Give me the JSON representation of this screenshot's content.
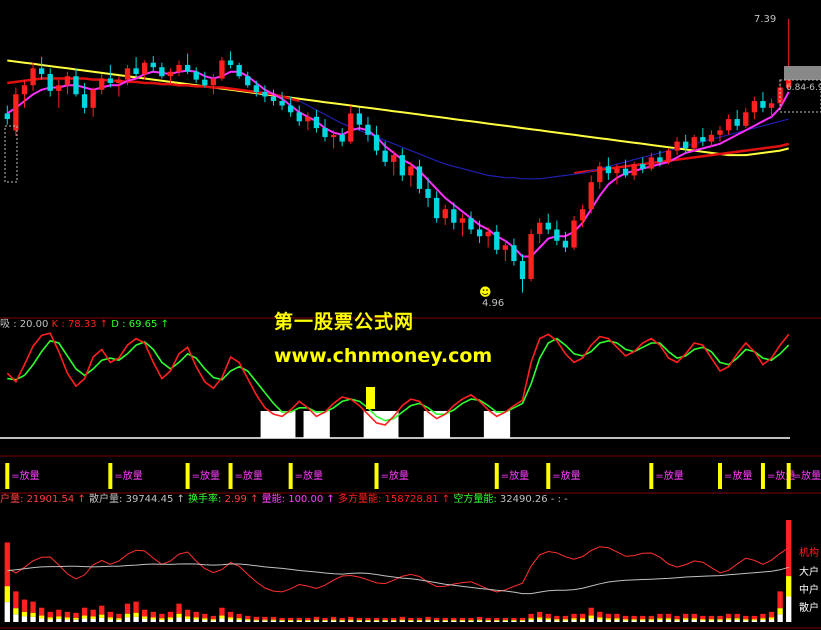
{
  "watermark": {
    "title": "第一股票公式网",
    "url": "www.chnmoney.com"
  },
  "colors": {
    "up": "#ff2020",
    "down": "#00d8e0",
    "ma_yellow": "#ffff40",
    "ma_red": "#e01010",
    "ma_blue": "#2020b0",
    "ma_magenta": "#ff30ff",
    "kdj_k": "#ff2020",
    "kdj_d": "#30ff30",
    "grid": "#800000"
  },
  "main_panel": {
    "high_label": "7.39",
    "low_label": "4.96",
    "price_box_label": "6.84-6.9"
  },
  "kdj_panel": {
    "label_prefix": "吸",
    "label_prefix_value": "20.00",
    "k_label": "K",
    "k_value": "78.33",
    "d_label": "D",
    "d_value": "69.65"
  },
  "signal_panel": {
    "signal_text": "=放量"
  },
  "volume_panel": {
    "items": [
      {
        "label": "户量:",
        "value": "21901.54"
      },
      {
        "label": "散户量:",
        "value": "39744.45"
      },
      {
        "label": "换手率:",
        "value": "2.99"
      },
      {
        "label": "量能:",
        "value": "100.00"
      },
      {
        "label": "多方量能:",
        "value": "158728.81"
      },
      {
        "label": "空方量能:",
        "value": "32490.26"
      }
    ],
    "legend": [
      "机构",
      "大户",
      "中户",
      "散户"
    ]
  },
  "chart_data": {
    "type": "candlestick",
    "ohlc": [
      [
        6.55,
        6.62,
        6.45,
        6.5
      ],
      [
        6.4,
        6.78,
        6.35,
        6.72
      ],
      [
        6.72,
        6.85,
        6.6,
        6.8
      ],
      [
        6.8,
        7.0,
        6.75,
        6.95
      ],
      [
        6.95,
        7.05,
        6.85,
        6.9
      ],
      [
        6.9,
        6.95,
        6.7,
        6.75
      ],
      [
        6.75,
        6.85,
        6.6,
        6.8
      ],
      [
        6.8,
        6.92,
        6.72,
        6.88
      ],
      [
        6.88,
        6.95,
        6.7,
        6.72
      ],
      [
        6.72,
        6.82,
        6.55,
        6.6
      ],
      [
        6.6,
        6.78,
        6.52,
        6.76
      ],
      [
        6.76,
        6.9,
        6.72,
        6.86
      ],
      [
        6.86,
        6.98,
        6.78,
        6.82
      ],
      [
        6.82,
        6.88,
        6.7,
        6.85
      ],
      [
        6.85,
        6.98,
        6.8,
        6.95
      ],
      [
        6.95,
        7.05,
        6.88,
        6.9
      ],
      [
        6.9,
        7.02,
        6.85,
        7.0
      ],
      [
        7.0,
        7.06,
        6.92,
        6.96
      ],
      [
        6.96,
        7.0,
        6.86,
        6.88
      ],
      [
        6.88,
        6.95,
        6.8,
        6.92
      ],
      [
        6.92,
        7.02,
        6.88,
        6.98
      ],
      [
        6.98,
        7.08,
        6.9,
        6.92
      ],
      [
        6.92,
        6.96,
        6.82,
        6.85
      ],
      [
        6.85,
        6.92,
        6.78,
        6.8
      ],
      [
        6.8,
        6.9,
        6.72,
        6.86
      ],
      [
        6.86,
        7.05,
        6.84,
        7.02
      ],
      [
        7.02,
        7.1,
        6.95,
        6.98
      ],
      [
        6.98,
        7.0,
        6.86,
        6.88
      ],
      [
        6.88,
        6.92,
        6.78,
        6.8
      ],
      [
        6.8,
        6.84,
        6.7,
        6.74
      ],
      [
        6.74,
        6.8,
        6.65,
        6.7
      ],
      [
        6.7,
        6.76,
        6.62,
        6.66
      ],
      [
        6.66,
        6.74,
        6.58,
        6.62
      ],
      [
        6.62,
        6.7,
        6.52,
        6.56
      ],
      [
        6.56,
        6.62,
        6.44,
        6.48
      ],
      [
        6.48,
        6.56,
        6.4,
        6.52
      ],
      [
        6.52,
        6.58,
        6.38,
        6.42
      ],
      [
        6.42,
        6.5,
        6.3,
        6.34
      ],
      [
        6.34,
        6.4,
        6.24,
        6.36
      ],
      [
        6.36,
        6.42,
        6.26,
        6.3
      ],
      [
        6.3,
        6.62,
        6.28,
        6.55
      ],
      [
        6.55,
        6.6,
        6.4,
        6.45
      ],
      [
        6.45,
        6.52,
        6.3,
        6.36
      ],
      [
        6.36,
        6.44,
        6.18,
        6.22
      ],
      [
        6.22,
        6.3,
        6.08,
        6.12
      ],
      [
        6.12,
        6.22,
        6.0,
        6.18
      ],
      [
        6.18,
        6.24,
        5.95,
        6.0
      ],
      [
        6.0,
        6.12,
        5.9,
        6.08
      ],
      [
        6.08,
        6.14,
        5.84,
        5.88
      ],
      [
        5.88,
        5.98,
        5.72,
        5.8
      ],
      [
        5.8,
        5.86,
        5.58,
        5.62
      ],
      [
        5.62,
        5.74,
        5.56,
        5.7
      ],
      [
        5.7,
        5.76,
        5.52,
        5.58
      ],
      [
        5.58,
        5.66,
        5.46,
        5.62
      ],
      [
        5.62,
        5.68,
        5.48,
        5.52
      ],
      [
        5.52,
        5.6,
        5.4,
        5.46
      ],
      [
        5.46,
        5.54,
        5.36,
        5.5
      ],
      [
        5.5,
        5.56,
        5.3,
        5.34
      ],
      [
        5.34,
        5.42,
        5.24,
        5.38
      ],
      [
        5.38,
        5.44,
        5.2,
        5.24
      ],
      [
        5.24,
        5.3,
        4.96,
        5.08
      ],
      [
        5.08,
        5.52,
        5.06,
        5.48
      ],
      [
        5.48,
        5.62,
        5.4,
        5.58
      ],
      [
        5.58,
        5.66,
        5.48,
        5.52
      ],
      [
        5.52,
        5.6,
        5.38,
        5.42
      ],
      [
        5.42,
        5.5,
        5.32,
        5.36
      ],
      [
        5.36,
        5.64,
        5.34,
        5.6
      ],
      [
        5.6,
        5.74,
        5.54,
        5.7
      ],
      [
        5.7,
        6.0,
        5.66,
        5.94
      ],
      [
        5.94,
        6.12,
        5.88,
        6.08
      ],
      [
        6.08,
        6.16,
        5.96,
        6.02
      ],
      [
        6.02,
        6.1,
        5.92,
        6.06
      ],
      [
        6.06,
        6.14,
        5.98,
        6.0
      ],
      [
        6.0,
        6.12,
        5.96,
        6.1
      ],
      [
        6.1,
        6.16,
        6.02,
        6.06
      ],
      [
        6.06,
        6.2,
        6.04,
        6.16
      ],
      [
        6.16,
        6.22,
        6.08,
        6.12
      ],
      [
        6.12,
        6.24,
        6.1,
        6.22
      ],
      [
        6.22,
        6.34,
        6.18,
        6.3
      ],
      [
        6.3,
        6.36,
        6.2,
        6.24
      ],
      [
        6.24,
        6.36,
        6.22,
        6.34
      ],
      [
        6.34,
        6.42,
        6.26,
        6.3
      ],
      [
        6.3,
        6.4,
        6.26,
        6.36
      ],
      [
        6.36,
        6.44,
        6.3,
        6.4
      ],
      [
        6.4,
        6.54,
        6.36,
        6.5
      ],
      [
        6.5,
        6.58,
        6.4,
        6.44
      ],
      [
        6.44,
        6.6,
        6.42,
        6.56
      ],
      [
        6.56,
        6.7,
        6.5,
        6.66
      ],
      [
        6.66,
        6.74,
        6.56,
        6.6
      ],
      [
        6.6,
        6.68,
        6.52,
        6.64
      ],
      [
        6.64,
        6.82,
        6.6,
        6.78
      ],
      [
        6.78,
        7.39,
        6.76,
        6.9
      ]
    ],
    "ma": {
      "yellow": [
        7.02,
        7.01,
        7.0,
        6.99,
        6.98,
        6.97,
        6.96,
        6.95,
        6.94,
        6.93,
        6.92,
        6.91,
        6.9,
        6.89,
        6.88,
        6.87,
        6.86,
        6.85,
        6.84,
        6.83,
        6.82,
        6.81,
        6.8,
        6.79,
        6.78,
        6.77,
        6.76,
        6.75,
        6.74,
        6.73,
        6.72,
        6.71,
        6.7,
        6.69,
        6.68,
        6.67,
        6.66,
        6.65,
        6.64,
        6.63,
        6.62,
        6.61,
        6.6,
        6.59,
        6.58,
        6.57,
        6.56,
        6.55,
        6.54,
        6.53,
        6.52,
        6.51,
        6.5,
        6.49,
        6.48,
        6.47,
        6.46,
        6.45,
        6.44,
        6.43,
        6.42,
        6.41,
        6.4,
        6.39,
        6.38,
        6.37,
        6.36,
        6.35,
        6.34,
        6.33,
        6.32,
        6.31,
        6.3,
        6.29,
        6.28,
        6.27,
        6.26,
        6.25,
        6.24,
        6.23,
        6.22,
        6.21,
        6.2,
        6.19,
        6.18,
        6.18,
        6.18,
        6.19,
        6.2,
        6.21,
        6.22,
        6.24
      ],
      "red": [
        6.82,
        6.83,
        6.84,
        6.85,
        6.86,
        6.86,
        6.86,
        6.86,
        6.86,
        6.86,
        6.85,
        6.85,
        6.84,
        6.84,
        6.83,
        6.83,
        6.82,
        6.82,
        6.81,
        6.81,
        6.8,
        6.8,
        6.79,
        6.79,
        6.78,
        6.78,
        6.77,
        6.76,
        6.75,
        6.74,
        6.73,
        6.72,
        6.7,
        6.68,
        6.66,
        null,
        null,
        null,
        null,
        null,
        null,
        null,
        null,
        null,
        null,
        null,
        null,
        null,
        null,
        null,
        null,
        null,
        null,
        null,
        null,
        null,
        null,
        null,
        null,
        null,
        null,
        null,
        null,
        null,
        null,
        null,
        6.02,
        6.03,
        6.04,
        6.05,
        6.06,
        6.07,
        6.08,
        6.09,
        6.1,
        6.11,
        6.12,
        6.13,
        6.14,
        6.15,
        6.16,
        6.17,
        6.18,
        6.19,
        6.2,
        6.21,
        6.22,
        6.23,
        6.24,
        6.25,
        6.26,
        6.28
      ],
      "blue": [
        null,
        null,
        null,
        null,
        null,
        null,
        null,
        null,
        null,
        null,
        null,
        null,
        null,
        null,
        null,
        null,
        null,
        null,
        null,
        null,
        null,
        null,
        null,
        null,
        null,
        null,
        null,
        null,
        null,
        null,
        null,
        null,
        null,
        null,
        6.66,
        6.62,
        6.58,
        6.54,
        6.5,
        6.46,
        6.43,
        6.4,
        6.37,
        6.34,
        6.31,
        6.28,
        6.25,
        6.22,
        6.19,
        6.16,
        6.13,
        6.1,
        6.08,
        6.06,
        6.04,
        6.02,
        6.0,
        5.99,
        5.98,
        5.98,
        5.97,
        5.97,
        5.97,
        5.98,
        5.99,
        6.0,
        6.01,
        6.02,
        6.04,
        6.06,
        6.08,
        6.1,
        6.12,
        6.14,
        6.16,
        6.18,
        6.2,
        6.22,
        6.24,
        6.26,
        6.28,
        6.3,
        6.32,
        6.34,
        6.36,
        6.38,
        6.4,
        6.42,
        6.44,
        6.46,
        6.48,
        6.5
      ],
      "magenta": [
        6.55,
        6.6,
        6.66,
        6.72,
        6.76,
        6.78,
        6.78,
        6.8,
        6.8,
        6.78,
        6.76,
        6.78,
        6.8,
        6.8,
        6.84,
        6.86,
        6.9,
        6.92,
        6.91,
        6.9,
        6.92,
        6.93,
        6.92,
        6.88,
        6.86,
        6.88,
        6.92,
        6.92,
        6.88,
        6.82,
        6.76,
        6.72,
        6.68,
        6.62,
        6.56,
        6.52,
        6.48,
        6.42,
        6.38,
        6.36,
        6.4,
        6.42,
        6.4,
        6.34,
        6.26,
        6.2,
        6.14,
        6.1,
        6.04,
        5.96,
        5.88,
        5.8,
        5.74,
        5.68,
        5.62,
        5.56,
        5.52,
        5.46,
        5.42,
        5.36,
        5.28,
        5.28,
        5.36,
        5.44,
        5.46,
        5.46,
        5.5,
        5.58,
        5.7,
        5.82,
        5.92,
        5.98,
        6.02,
        6.04,
        6.06,
        6.08,
        6.1,
        6.12,
        6.16,
        6.2,
        6.22,
        6.24,
        6.26,
        6.28,
        6.32,
        6.36,
        6.4,
        6.44,
        6.48,
        6.52,
        6.6,
        6.74
      ]
    },
    "kdj": {
      "k": [
        60,
        52,
        68,
        85,
        95,
        97,
        80,
        60,
        48,
        55,
        75,
        82,
        70,
        74,
        86,
        92,
        88,
        70,
        55,
        62,
        78,
        84,
        66,
        52,
        46,
        56,
        75,
        70,
        55,
        40,
        28,
        22,
        20,
        26,
        34,
        28,
        20,
        24,
        32,
        38,
        36,
        30,
        22,
        14,
        12,
        20,
        30,
        36,
        34,
        24,
        18,
        22,
        30,
        36,
        40,
        34,
        26,
        20,
        24,
        30,
        35,
        70,
        92,
        96,
        90,
        78,
        70,
        74,
        86,
        94,
        92,
        84,
        76,
        80,
        88,
        92,
        86,
        74,
        70,
        78,
        88,
        86,
        74,
        62,
        66,
        78,
        88,
        80,
        68,
        74,
        86,
        96
      ],
      "d": [
        55,
        54,
        58,
        68,
        80,
        90,
        88,
        76,
        64,
        58,
        64,
        72,
        74,
        72,
        78,
        86,
        89,
        82,
        70,
        64,
        70,
        78,
        74,
        64,
        56,
        54,
        62,
        66,
        62,
        52,
        42,
        32,
        24,
        24,
        28,
        28,
        24,
        24,
        28,
        34,
        36,
        34,
        28,
        20,
        16,
        18,
        24,
        30,
        32,
        28,
        22,
        22,
        26,
        32,
        36,
        35,
        30,
        24,
        24,
        28,
        32,
        50,
        74,
        88,
        92,
        86,
        78,
        76,
        80,
        88,
        90,
        88,
        82,
        80,
        84,
        88,
        88,
        80,
        74,
        76,
        82,
        84,
        80,
        70,
        68,
        74,
        82,
        80,
        74,
        72,
        78,
        86
      ]
    },
    "volume": [
      78,
      30,
      22,
      20,
      14,
      10,
      12,
      10,
      9,
      14,
      12,
      16,
      10,
      8,
      18,
      20,
      12,
      10,
      8,
      10,
      18,
      12,
      10,
      8,
      6,
      14,
      10,
      8,
      6,
      5,
      5,
      5,
      4,
      4,
      4,
      4,
      5,
      4,
      5,
      4,
      5,
      4,
      4,
      4,
      4,
      4,
      5,
      4,
      4,
      5,
      4,
      4,
      4,
      4,
      4,
      5,
      4,
      4,
      4,
      4,
      4,
      8,
      10,
      8,
      6,
      6,
      8,
      8,
      14,
      10,
      8,
      8,
      6,
      6,
      6,
      6,
      8,
      8,
      6,
      8,
      8,
      6,
      6,
      6,
      8,
      8,
      6,
      6,
      8,
      10,
      30,
      100
    ],
    "xlabel": "",
    "ylabel": ""
  }
}
